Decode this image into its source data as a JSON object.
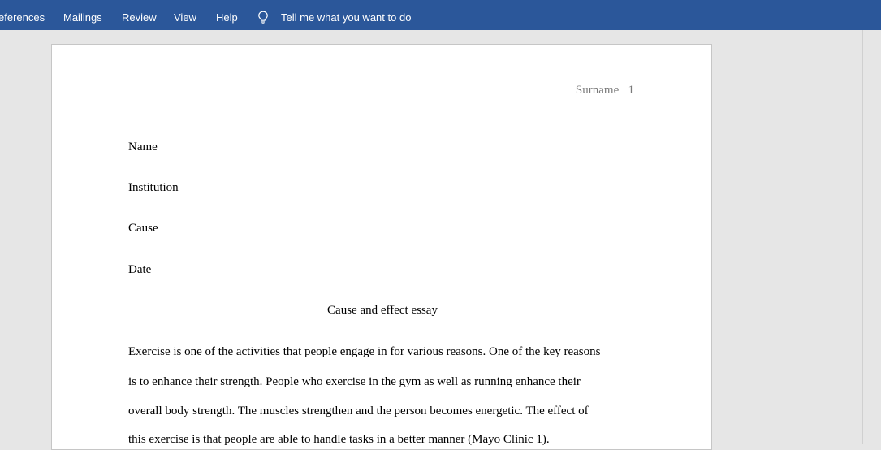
{
  "ribbon": {
    "tabs": [
      {
        "label": "eferences"
      },
      {
        "label": "Mailings"
      },
      {
        "label": "Review"
      },
      {
        "label": "View"
      },
      {
        "label": "Help"
      }
    ],
    "tell_me": "Tell me what you want to do",
    "background_color": "#2b579a"
  },
  "document": {
    "header": "Surname   1",
    "heading_lines": [
      "Name",
      "Institution",
      "Cause",
      "Date"
    ],
    "title": "Cause and effect essay",
    "body_lines": [
      "Exercise is one of the activities that people engage in for various reasons. One of the key reasons",
      "is to enhance their strength. People who exercise in the gym as well as running enhance their",
      "overall body strength. The muscles strengthen and the person becomes energetic. The effect of",
      "this exercise is that people are able to handle tasks in a better manner (Mayo Clinic 1)."
    ]
  }
}
